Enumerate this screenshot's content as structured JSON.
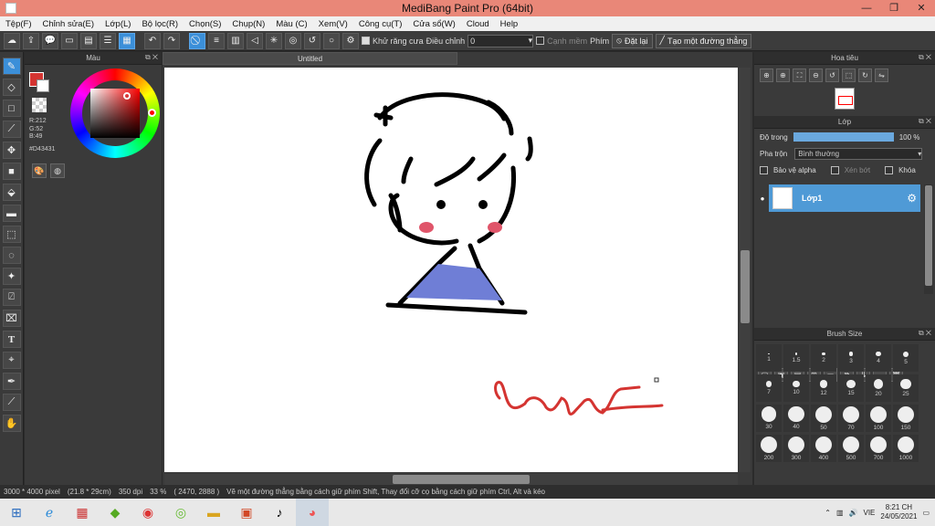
{
  "window": {
    "title": "MediBang Paint Pro (64bit)"
  },
  "menu": [
    "Tệp(F)",
    "Chỉnh sửa(E)",
    "Lớp(L)",
    "Bộ lọc(R)",
    "Chọn(S)",
    "Chụp(N)",
    "Màu (C)",
    "Xem(V)",
    "Công cụ(T)",
    "Cửa sổ(W)",
    "Cloud",
    "Help"
  ],
  "toolbar": {
    "antialias_label": "Khử răng cưa",
    "correction_label": "Điều chỉnh",
    "correction_value": "0",
    "edge_label": "Cạnh mềm",
    "key_label": "Phím",
    "reset_label": "Đặt lại",
    "line_label": "Tạo một đường thẳng"
  },
  "color_panel": {
    "title": "Màu",
    "r": "R:212",
    "g": "G:52",
    "b": "B:49",
    "hex": "#D43431",
    "foreground_color": "#d43431"
  },
  "document": {
    "tab_title": "Untitled"
  },
  "navigator": {
    "title": "Hoa tiêu"
  },
  "layers": {
    "title": "Lớp",
    "opacity_label": "Độ trong",
    "opacity_value": "100 %",
    "opacity_fraction": 1.0,
    "blend_label": "Pha trộn",
    "blend_value": "Bình thường",
    "protect_alpha_label": "Bảo vệ alpha",
    "clipping_label": "Xén bớt",
    "lock_label": "Khóa",
    "items": [
      {
        "name": "Lớp1"
      }
    ]
  },
  "brush_size": {
    "title": "Brush Size",
    "sizes": [
      "1",
      "1.5",
      "2",
      "3",
      "4",
      "5",
      "7",
      "10",
      "12",
      "15",
      "20",
      "25",
      "30",
      "40",
      "50",
      "70",
      "100",
      "150",
      "200",
      "300",
      "400",
      "500",
      "700",
      "1000"
    ]
  },
  "status": {
    "dimensions": "3000 * 4000 pixel",
    "physical": "(21.8 * 29cm)",
    "dpi": "350 dpi",
    "zoom": "33 %",
    "coords": "( 2470, 2888 )",
    "hint": "Vẽ một đường thẳng bằng cách giữ phím Shift, Thay đổi cỡ cọ bằng cách giữ phím Ctrl, Alt và kéo"
  },
  "taskbar": {
    "lang": "VIE",
    "time": "8:21 CH",
    "date": "24/05/2021"
  },
  "drawing": {
    "signature_text": "chmy 2K7"
  }
}
